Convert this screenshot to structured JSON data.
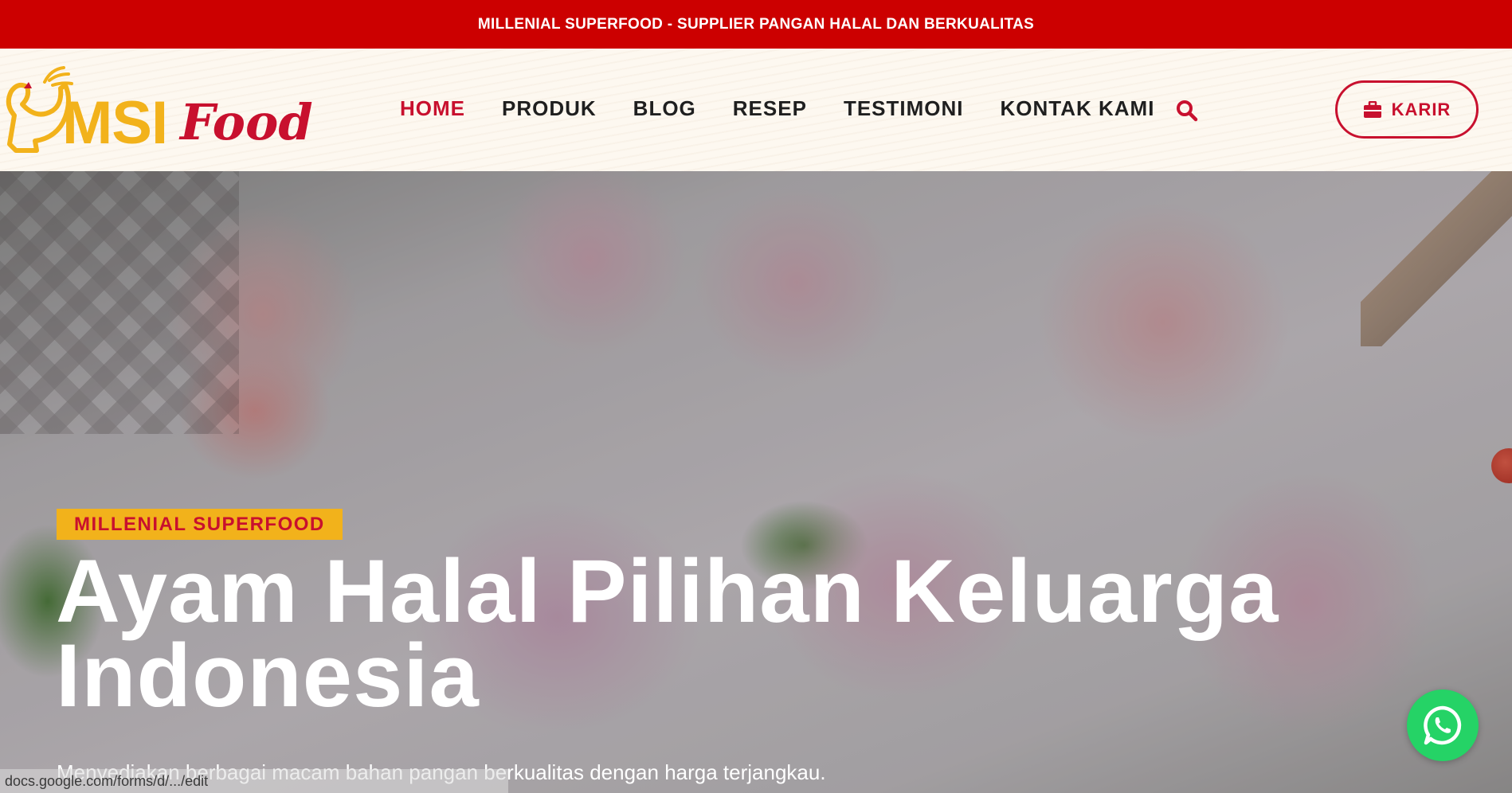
{
  "announcement": {
    "text": "MILLENIAL SUPERFOOD - SUPPLIER PANGAN HALAL DAN BERKUALITAS"
  },
  "logo": {
    "msi": "MSI",
    "food": "Food"
  },
  "nav": {
    "items": [
      {
        "label": "HOME",
        "active": true
      },
      {
        "label": "PRODUK"
      },
      {
        "label": "BLOG"
      },
      {
        "label": "RESEP"
      },
      {
        "label": "TESTIMONI"
      },
      {
        "label": "KONTAK KAMI"
      }
    ],
    "search_icon": "search-icon"
  },
  "karir": {
    "label": "KARIR",
    "icon": "briefcase-icon"
  },
  "hero": {
    "badge": "MILLENIAL SUPERFOOD",
    "title": "Ayam Halal Pilihan Keluarga Indonesia",
    "subtitle": "Menyediakan berbagai macam bahan pangan berkualitas dengan harga terjangkau."
  },
  "status_bar": {
    "url": "docs.google.com/forms/d/.../edit"
  },
  "whatsapp": {
    "icon": "whatsapp-icon"
  },
  "colors": {
    "brand_red": "#cc0000",
    "accent_red": "#c8102e",
    "brand_yellow": "#f2b21b",
    "whatsapp_green": "#25d366"
  }
}
